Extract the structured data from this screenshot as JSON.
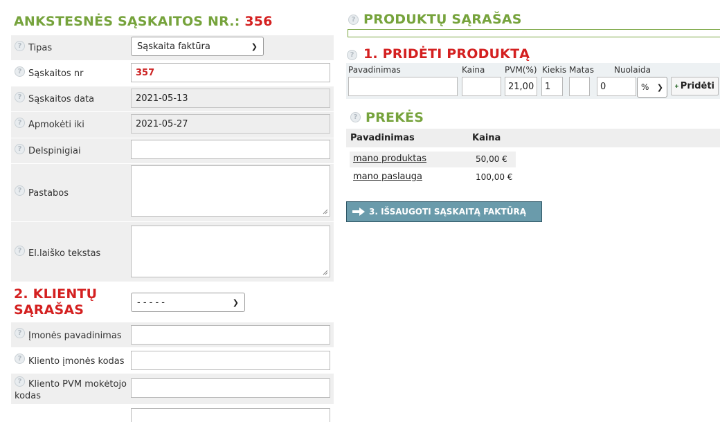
{
  "left": {
    "title_prefix": "ANKSTESNĖS SĄSKAITOS NR.:",
    "title_number": "356",
    "fields": {
      "tipas": {
        "label": "Tipas",
        "value": "Sąskaita faktūra"
      },
      "saskaitos_nr": {
        "label": "Sąskaitos nr",
        "value": "357"
      },
      "saskaitos_data": {
        "label": "Sąskaitos data",
        "value": "2021-05-13"
      },
      "apmoketi_iki": {
        "label": "Apmokėti iki",
        "value": "2021-05-27"
      },
      "delspinigiai": {
        "label": "Delspinigiai",
        "value": ""
      },
      "pastabos": {
        "label": "Pastabos",
        "value": ""
      },
      "el_laisko_tekstas": {
        "label": "El.laiško tekstas",
        "value": ""
      }
    },
    "clients": {
      "title_line1": "2. KLIENTŲ",
      "title_line2": "SĄRAŠAS",
      "select_value": "- - - - -",
      "imones_pavadinimas": {
        "label": "Įmonės pavadinimas",
        "value": ""
      },
      "kliento_imones_kodas": {
        "label": "Kliento įmonės kodas",
        "value": ""
      },
      "kliento_pvm_line1": "Kliento PVM mokėtojo",
      "kliento_pvm_line2": "kodas",
      "kliento_pvm_value": ""
    }
  },
  "right": {
    "products_title": "PRODUKTŲ SĄRAŠAS",
    "add": {
      "title": "1. PRIDĖTI PRODUKTĄ",
      "col_name": "Pavadinimas",
      "col_price": "Kaina",
      "col_vat": "PVM(%)",
      "col_qty": "Kiekis",
      "col_unit": "Matas",
      "col_discount": "Nuolaida",
      "name_value": "",
      "price_value": "",
      "vat_value": "21,00",
      "qty_value": "1",
      "unit_value": "",
      "discount_value": "0",
      "discount_type": "%",
      "add_button": "Pridėti"
    },
    "goods": {
      "title": "PREKĖS",
      "head_name": "Pavadinimas",
      "head_price": "Kaina",
      "items": [
        {
          "name": "mano produktas",
          "price": "50,00 €"
        },
        {
          "name": "mano paslauga",
          "price": "100,00 €"
        }
      ]
    },
    "save_button": "3. IŠSAUGOTI SĄSKAITĄ FAKTŪRĄ"
  },
  "icons": {
    "help": "help-icon",
    "plus": "plus-icon",
    "arrow": "arrow-right-icon",
    "chevron": "chevron-down-icon"
  },
  "colors": {
    "green_title": "#76a33c",
    "red_title": "#d42020",
    "row_shade": "#efefef",
    "save_button_bg": "#6a9bab"
  }
}
